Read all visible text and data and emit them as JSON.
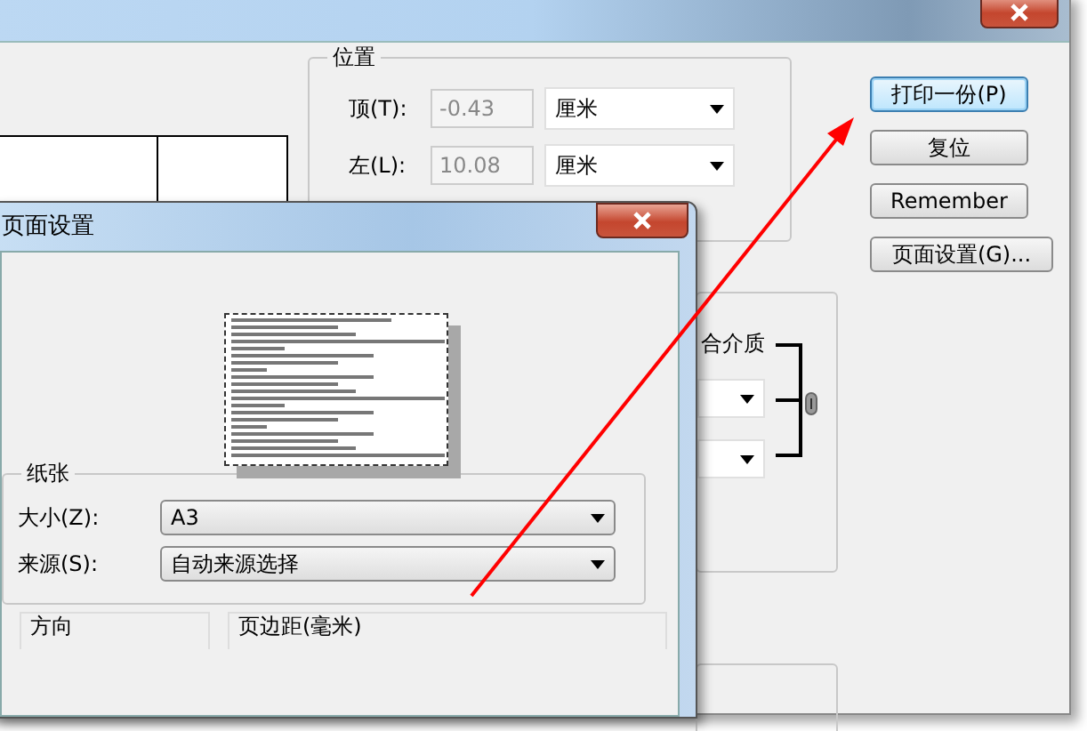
{
  "main_window": {
    "position_group": {
      "title": "位置",
      "rows": [
        {
          "label": "顶(T):",
          "value": "-0.43",
          "disabled": true,
          "unit": "厘米"
        },
        {
          "label": "左(L):",
          "value": "10.08",
          "disabled": true,
          "unit": "厘米"
        }
      ]
    },
    "scale_group": {
      "label": "合介质",
      "linked": true
    },
    "buttons": [
      {
        "label": "打印一份(P)",
        "focused": true
      },
      {
        "label": "复位",
        "focused": false
      },
      {
        "label": "Remember",
        "focused": false
      },
      {
        "label": "页面设置(G)...",
        "focused": false
      }
    ]
  },
  "page_setup_dialog": {
    "title": "页面设置",
    "paper_group": {
      "title": "纸张",
      "fields": [
        {
          "label": "大小(Z):",
          "value": "A3"
        },
        {
          "label": "来源(S):",
          "value": "自动来源选择"
        }
      ]
    },
    "orientation_group": {
      "title": "方向"
    },
    "margins_group": {
      "title": "页边距(毫米)"
    }
  }
}
